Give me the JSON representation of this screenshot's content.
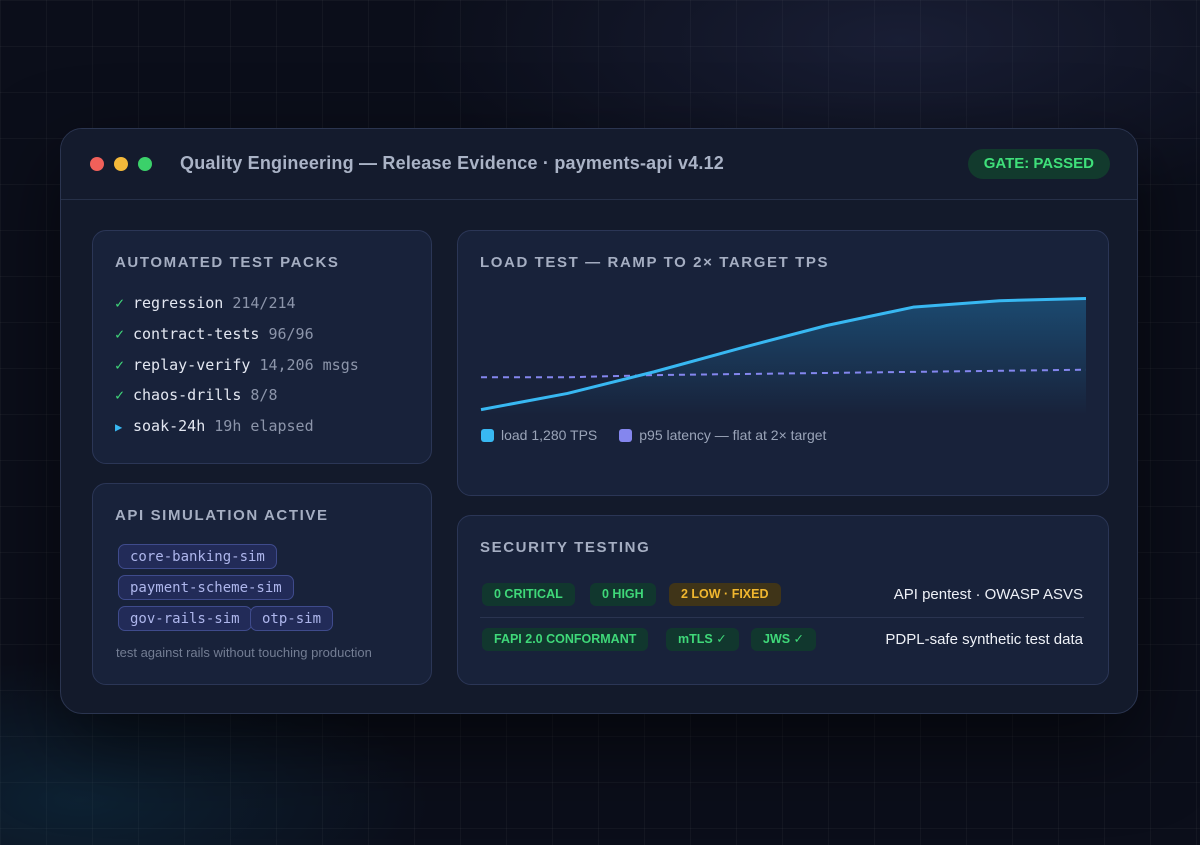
{
  "window": {
    "title": "Quality Engineering — Release Evidence · payments-api v4.12",
    "gate_badge": "GATE: PASSED"
  },
  "test_packs": {
    "title": "AUTOMATED TEST PACKS",
    "items": [
      {
        "status": "passed",
        "mark": "✓",
        "name": "regression",
        "value": "214/214"
      },
      {
        "status": "passed",
        "mark": "✓",
        "name": "contract-tests",
        "value": "96/96"
      },
      {
        "status": "passed",
        "mark": "✓",
        "name": "replay-verify",
        "value": "14,206 msgs"
      },
      {
        "status": "passed",
        "mark": "✓",
        "name": "chaos-drills",
        "value": "8/8"
      },
      {
        "status": "running",
        "mark": "▶",
        "name": "soak-24h",
        "value": "19h elapsed"
      }
    ]
  },
  "api_simulation": {
    "title": "API SIMULATION ACTIVE",
    "simulators": [
      "core-banking-sim",
      "payment-scheme-sim",
      "gov-rails-sim",
      "otp-sim"
    ],
    "note": "test against rails without touching production"
  },
  "load_test": {
    "title": "LOAD TEST — RAMP TO 2× TARGET TPS",
    "legend": [
      {
        "label": "load 1,280 TPS",
        "color": "#38b8f2"
      },
      {
        "label": "p95 latency — flat at 2× target",
        "color": "#8486ee"
      }
    ]
  },
  "chart_data": {
    "type": "line",
    "title": "LOAD TEST — RAMP TO 2× TARGET TPS",
    "xlabel": "",
    "ylabel": "",
    "ylim": [
      0,
      1
    ],
    "grid": false,
    "legend_position": "bottom-left",
    "x": [
      0,
      1,
      2,
      3,
      4,
      5,
      6,
      7
    ],
    "series": [
      {
        "name": "load 1,280 TPS",
        "color": "#38b8f2",
        "style": "solid-area",
        "values": [
          0.05,
          0.2,
          0.4,
          0.62,
          0.83,
          1.0,
          1.06,
          1.08
        ]
      },
      {
        "name": "p95 latency — flat at 2× target",
        "color": "#8486ee",
        "style": "dashed",
        "values": [
          0.35,
          0.35,
          0.37,
          0.38,
          0.39,
          0.4,
          0.41,
          0.42
        ]
      }
    ]
  },
  "security": {
    "title": "SECURITY TESTING",
    "rows": [
      {
        "badges": [
          {
            "text": "0 CRITICAL",
            "tone": "green"
          },
          {
            "text": "0 HIGH",
            "tone": "green"
          },
          {
            "text": "2 LOW · FIXED",
            "tone": "amber"
          }
        ],
        "label": "API pentest · OWASP ASVS"
      },
      {
        "badges": [
          {
            "text": "FAPI 2.0 CONFORMANT",
            "tone": "green"
          },
          {
            "text": "mTLS ✓",
            "tone": "green"
          },
          {
            "text": "JWS ✓",
            "tone": "green"
          }
        ],
        "label": "PDPL-safe synthetic test data"
      }
    ]
  },
  "colors": {
    "gate_text": "#3fe07a",
    "pass_check": "#3fd479",
    "running": "#38b8f2",
    "load_line": "#38b8f2",
    "latency_line": "#8486ee",
    "amber": "#f1b72f"
  }
}
